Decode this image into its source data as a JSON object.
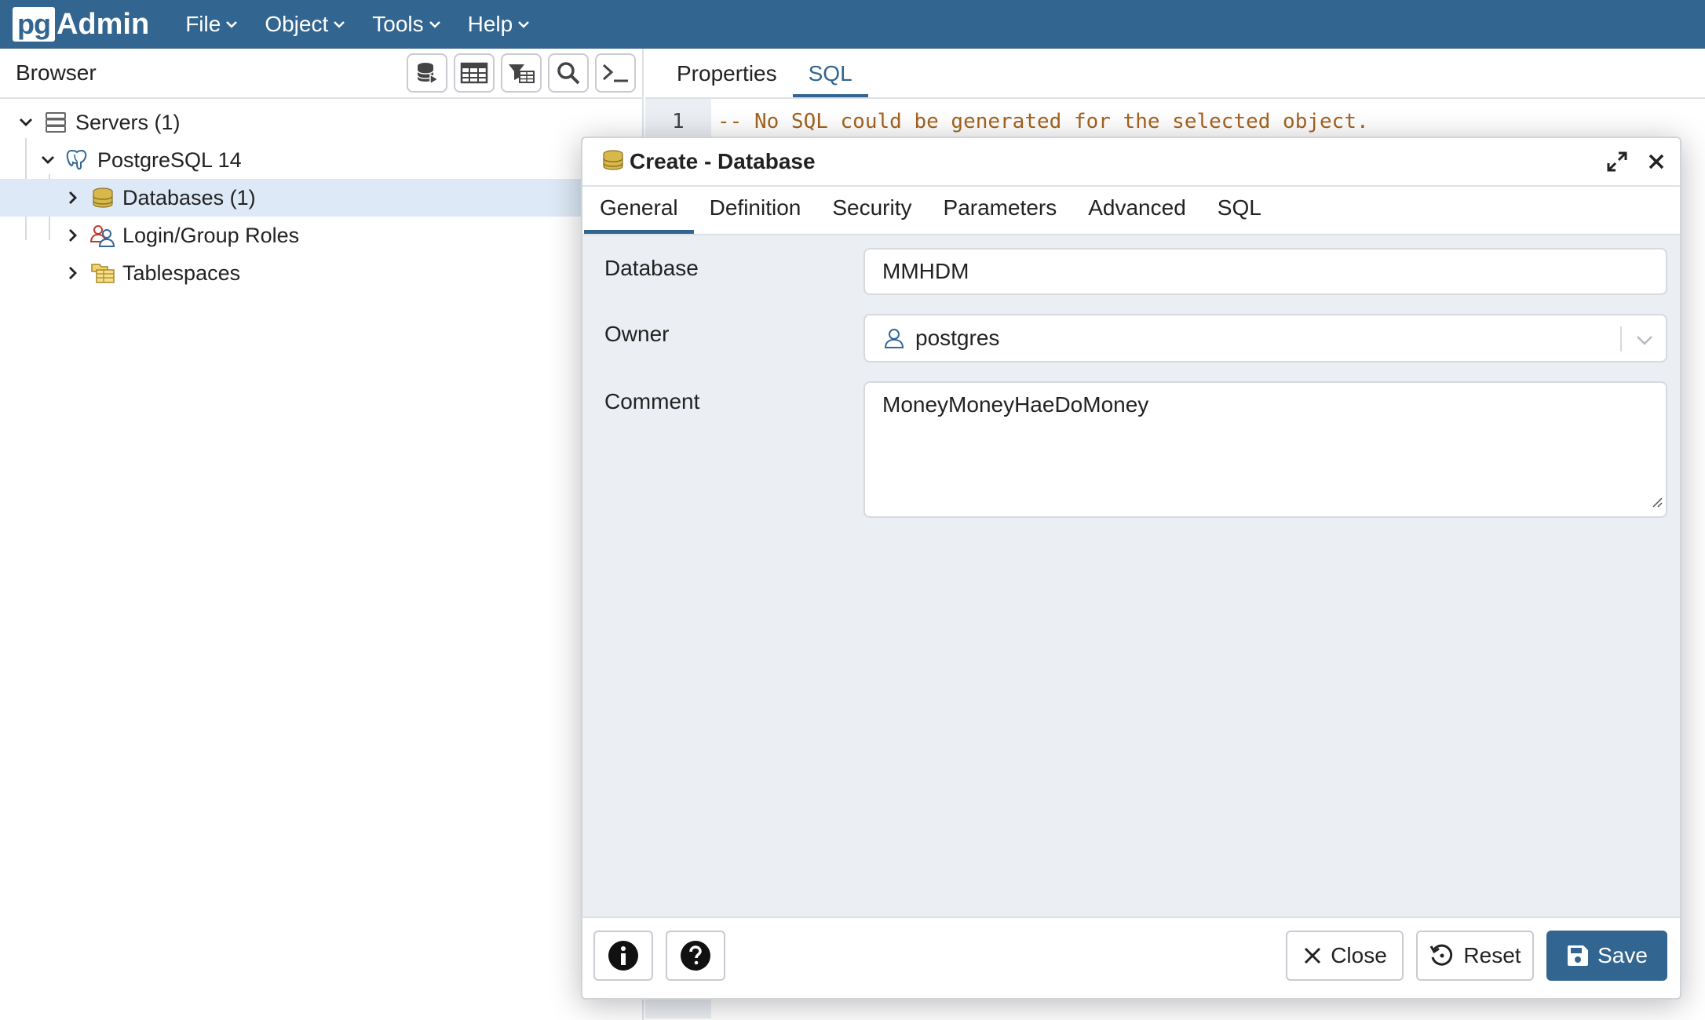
{
  "app": {
    "logo_pg": "pg",
    "logo_admin": "Admin",
    "menu": [
      "File",
      "Object",
      "Tools",
      "Help"
    ]
  },
  "browser": {
    "title": "Browser",
    "toolbar_icons": [
      "query-tool-icon",
      "view-data-icon",
      "filtered-rows-icon",
      "search-objects-icon",
      "psql-tool-icon"
    ],
    "tree": [
      {
        "label": "Servers (1)",
        "icon": "servers-icon",
        "expanded": true
      },
      {
        "label": "PostgreSQL 14",
        "icon": "elephant-icon",
        "expanded": true
      },
      {
        "label": "Databases (1)",
        "icon": "database-icon",
        "expanded": false,
        "selected": true
      },
      {
        "label": "Login/Group Roles",
        "icon": "roles-icon",
        "expanded": false
      },
      {
        "label": "Tablespaces",
        "icon": "tablespace-icon",
        "expanded": false
      }
    ]
  },
  "right_panel": {
    "tabs": [
      "Properties",
      "SQL"
    ],
    "active_tab": "SQL",
    "line_number": "1",
    "sql_line": "-- No SQL could be generated for the selected object."
  },
  "dialog": {
    "title": "Create - Database",
    "tabs": [
      "General",
      "Definition",
      "Security",
      "Parameters",
      "Advanced",
      "SQL"
    ],
    "active_tab": "General",
    "fields": {
      "database_label": "Database",
      "database_value": "MMHDM",
      "owner_label": "Owner",
      "owner_value": "postgres",
      "comment_label": "Comment",
      "comment_value": "MoneyMoneyHaeDoMoney"
    },
    "footer": {
      "close_label": "Close",
      "reset_label": "Reset",
      "save_label": "Save"
    }
  },
  "colors": {
    "brand": "#326690",
    "selection": "#dde9f6",
    "sql_comment": "#a5631e",
    "panel_bg": "#ebeef3"
  }
}
